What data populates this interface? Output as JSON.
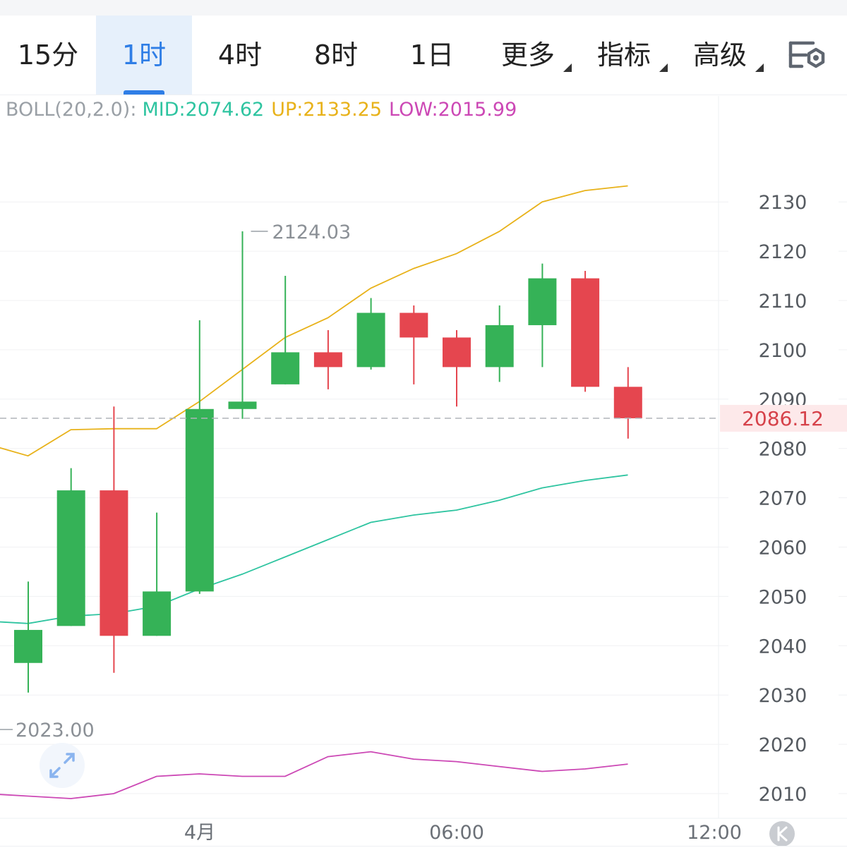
{
  "tabs": [
    {
      "label": "15分",
      "active": false,
      "dropdown": false
    },
    {
      "label": "1时",
      "active": true,
      "dropdown": false
    },
    {
      "label": "4时",
      "active": false,
      "dropdown": false
    },
    {
      "label": "8时",
      "active": false,
      "dropdown": false
    },
    {
      "label": "1日",
      "active": false,
      "dropdown": false
    },
    {
      "label": "更多",
      "active": false,
      "dropdown": true
    },
    {
      "label": "指标",
      "active": false,
      "dropdown": true
    },
    {
      "label": "高级",
      "active": false,
      "dropdown": true
    }
  ],
  "settings_icon": "chart-settings-icon",
  "boll": {
    "label": "BOLL(20,2.0):",
    "mid": "MID:2074.62",
    "up": "UP:2133.25",
    "low": "LOW:2015.99"
  },
  "expand_icon": "expand-icon",
  "kline_icon": "k-logo-icon",
  "colors": {
    "up_candle": "#35b257",
    "down_candle": "#e5464f",
    "mid": "#2ec4a0",
    "upper": "#e8b21a",
    "lower": "#cc48b5",
    "accent": "#2f7ee6",
    "price_tag": "#d6424a"
  },
  "chart_data": {
    "type": "candlestick",
    "y_ticks": [
      "2130",
      "2120",
      "2110",
      "2100",
      "2090",
      "2080",
      "2070",
      "2060",
      "2050",
      "2040",
      "2030",
      "2020",
      "2010"
    ],
    "x_ticks": [
      "4月",
      "06:00",
      "12:00"
    ],
    "current_price": "2086.12",
    "high_label": "2124.03",
    "low_label": "2023.00",
    "ylim": [
      2003.5,
      2151
    ],
    "candles": [
      {
        "open": 2036.5,
        "close": 2043.2,
        "high": 2053.0,
        "low": 2030.5
      },
      {
        "open": 2044.0,
        "close": 2071.5,
        "high": 2076.0,
        "low": 2044.0
      },
      {
        "open": 2071.5,
        "close": 2042.0,
        "high": 2088.5,
        "low": 2034.5
      },
      {
        "open": 2042.0,
        "close": 2051.0,
        "high": 2067.0,
        "low": 2042.0
      },
      {
        "open": 2051.0,
        "close": 2088.0,
        "high": 2106.0,
        "low": 2050.5
      },
      {
        "open": 2088.0,
        "close": 2089.5,
        "high": 2124.03,
        "low": 2086.0
      },
      {
        "open": 2093.0,
        "close": 2099.5,
        "high": 2115.0,
        "low": 2093.0
      },
      {
        "open": 2099.5,
        "close": 2096.5,
        "high": 2104.0,
        "low": 2092.0
      },
      {
        "open": 2096.5,
        "close": 2107.5,
        "high": 2110.5,
        "low": 2096.0
      },
      {
        "open": 2107.5,
        "close": 2102.5,
        "high": 2109.0,
        "low": 2093.0
      },
      {
        "open": 2102.5,
        "close": 2096.5,
        "high": 2104.0,
        "low": 2088.5
      },
      {
        "open": 2096.5,
        "close": 2105.0,
        "high": 2109.0,
        "low": 2093.5
      },
      {
        "open": 2105.0,
        "close": 2114.5,
        "high": 2117.5,
        "low": 2096.5
      },
      {
        "open": 2114.5,
        "close": 2092.5,
        "high": 2116.0,
        "low": 2091.5
      },
      {
        "open": 2092.5,
        "close": 2086.12,
        "high": 2096.5,
        "low": 2082.0
      }
    ],
    "upper_band": [
      2081.0,
      2078.5,
      2083.8,
      2084.0,
      2084.0,
      2089.5,
      2096.0,
      2102.5,
      2106.5,
      2112.5,
      2116.5,
      2119.5,
      2124.0,
      2130.0,
      2132.3,
      2133.25
    ],
    "mid_band": [
      2045.0,
      2044.5,
      2046.0,
      2046.5,
      2048.0,
      2051.5,
      2054.5,
      2058.0,
      2061.5,
      2065.0,
      2066.5,
      2067.5,
      2069.5,
      2072.0,
      2073.5,
      2074.62
    ],
    "lower_band": [
      2010.0,
      2009.5,
      2009.0,
      2010.0,
      2013.5,
      2014.0,
      2013.5,
      2013.5,
      2017.5,
      2018.5,
      2017.0,
      2016.5,
      2015.5,
      2014.5,
      2015.0,
      2015.99
    ]
  }
}
